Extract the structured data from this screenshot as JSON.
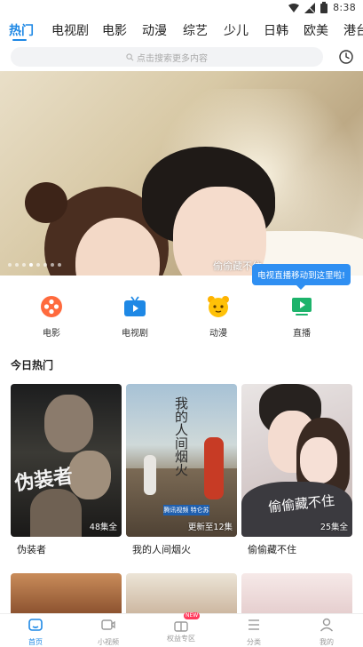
{
  "status_bar": {
    "time": "8:38"
  },
  "tabs": [
    "热门",
    "电视剧",
    "电影",
    "动漫",
    "综艺",
    "少儿",
    "日韩",
    "欧美",
    "港台"
  ],
  "search": {
    "placeholder": "点击搜索更多内容"
  },
  "banner": {
    "title": "偷偷藏不住",
    "slide_index": 4,
    "slide_count": 8
  },
  "tooltip": "电视直播移动到这里啦!",
  "quick_links": [
    {
      "label": "电影",
      "icon": "film-reel-icon"
    },
    {
      "label": "电视剧",
      "icon": "tv-icon"
    },
    {
      "label": "动漫",
      "icon": "cartoon-face-icon"
    },
    {
      "label": "直播",
      "icon": "live-play-icon"
    }
  ],
  "section_title": "今日热门",
  "cards": [
    {
      "title": "伪装者",
      "episodes": "48集全",
      "calligraphy": "伪装者"
    },
    {
      "title": "我的人间烟火",
      "episodes": "更新至12集",
      "calligraphy": "我的人间烟火",
      "tag": "腾讯视频 特仑苏"
    },
    {
      "title": "偷偷藏不住",
      "episodes": "25集全",
      "calligraphy": "偷偷藏不住"
    }
  ],
  "bottom_nav": [
    {
      "label": "首页",
      "icon": "home-icon",
      "active": true
    },
    {
      "label": "小视频",
      "icon": "video-icon",
      "active": false
    },
    {
      "label": "权益专区",
      "icon": "gift-icon",
      "active": false,
      "badge": "NEW"
    },
    {
      "label": "分类",
      "icon": "category-list-icon",
      "active": false
    },
    {
      "label": "我的",
      "icon": "profile-icon",
      "active": false
    }
  ],
  "colors": {
    "accent": "#1e88e5",
    "tooltip": "#2f8ff2",
    "new_badge": "#ff3b5c"
  }
}
